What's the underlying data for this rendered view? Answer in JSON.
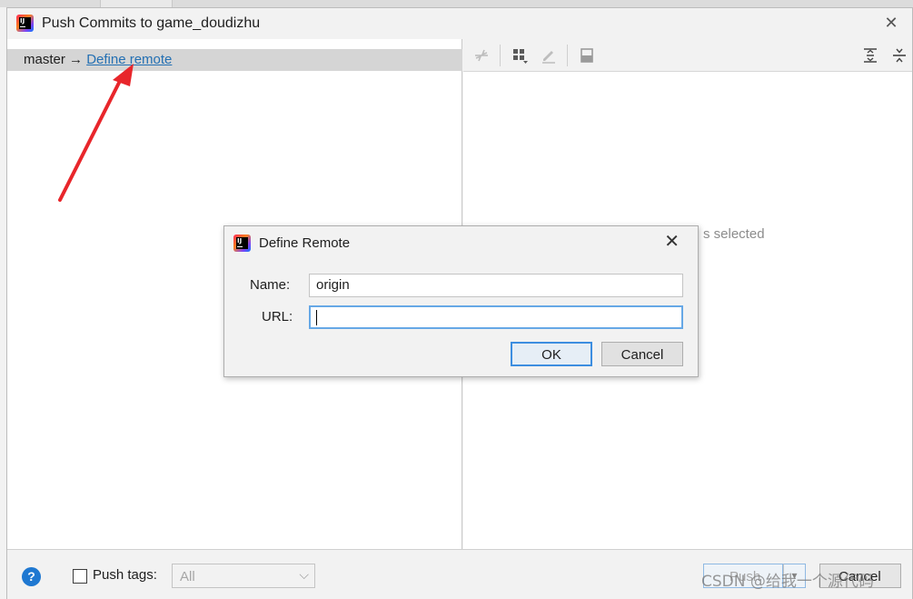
{
  "window": {
    "title": "Push Commits to game_doudizhu",
    "logo_text": "IJ"
  },
  "branch": {
    "local": "master",
    "arrow": "→",
    "link": "Define remote"
  },
  "details": {
    "empty_text": "s selected"
  },
  "bottom": {
    "push_tags_label": "Push tags:",
    "tags_value": "All",
    "push_label": "Push",
    "cancel_label": "Cancel",
    "help_glyph": "?"
  },
  "dialog": {
    "title": "Define Remote",
    "name_label": "Name:",
    "name_value": "origin",
    "url_label": "URL:",
    "url_value": "",
    "ok_label": "OK",
    "cancel_label": "Cancel"
  },
  "watermark": "CSDN @给我一个源代码",
  "colors": {
    "link": "#2470b3",
    "annotation_arrow": "#e8262b",
    "focus": "#3d8ee0"
  },
  "icons": [
    "collapse-icon",
    "group-by-icon",
    "edit-icon",
    "preview-icon",
    "expand-all-icon",
    "collapse-all-icon",
    "close-icon",
    "help-icon",
    "chevron-down-icon"
  ]
}
